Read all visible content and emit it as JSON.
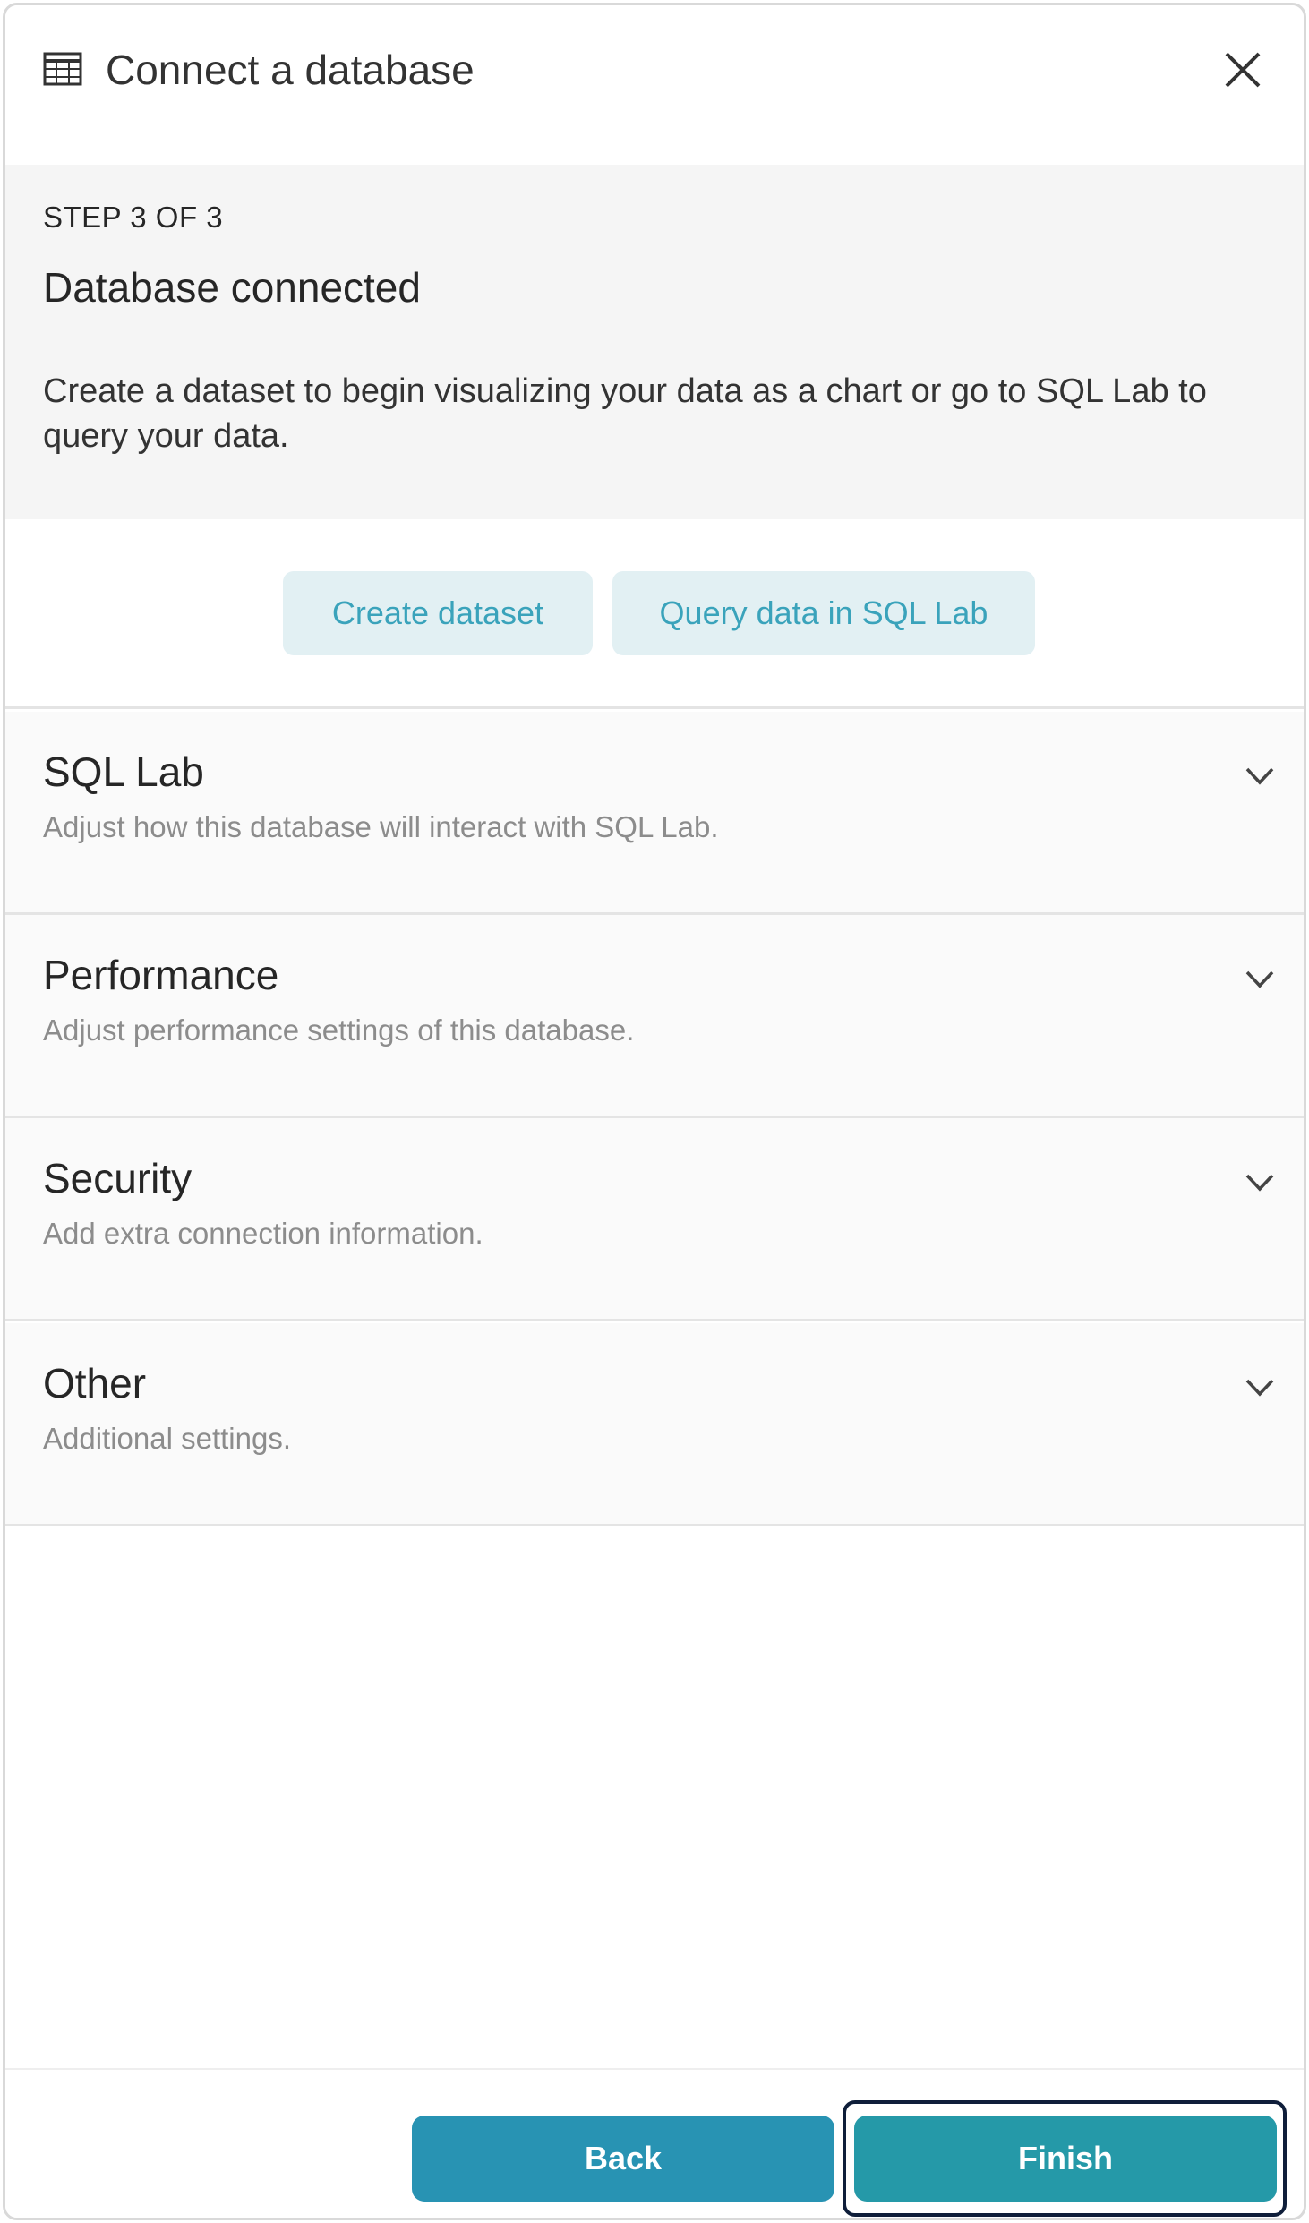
{
  "modal": {
    "title": "Connect a database",
    "title_icon": "table-icon",
    "close_icon": "close-icon"
  },
  "step": {
    "label": "STEP 3 OF 3",
    "heading": "Database connected",
    "description": "Create a dataset to begin visualizing your data as a chart or go to SQL Lab to query your data."
  },
  "actions": {
    "create_dataset": "Create dataset",
    "query_sql_lab": "Query data in SQL Lab"
  },
  "sections": [
    {
      "title": "SQL Lab",
      "subtitle": "Adjust how this database will interact with SQL Lab."
    },
    {
      "title": "Performance",
      "subtitle": "Adjust performance settings of this database."
    },
    {
      "title": "Security",
      "subtitle": "Add extra connection information."
    },
    {
      "title": "Other",
      "subtitle": "Additional settings."
    }
  ],
  "footer": {
    "back_label": "Back",
    "finish_label": "Finish"
  },
  "colors": {
    "primary": "#2893b3",
    "finish": "#2599a8",
    "pill_bg": "#e2f0f3",
    "pill_text": "#3aa3bb"
  }
}
